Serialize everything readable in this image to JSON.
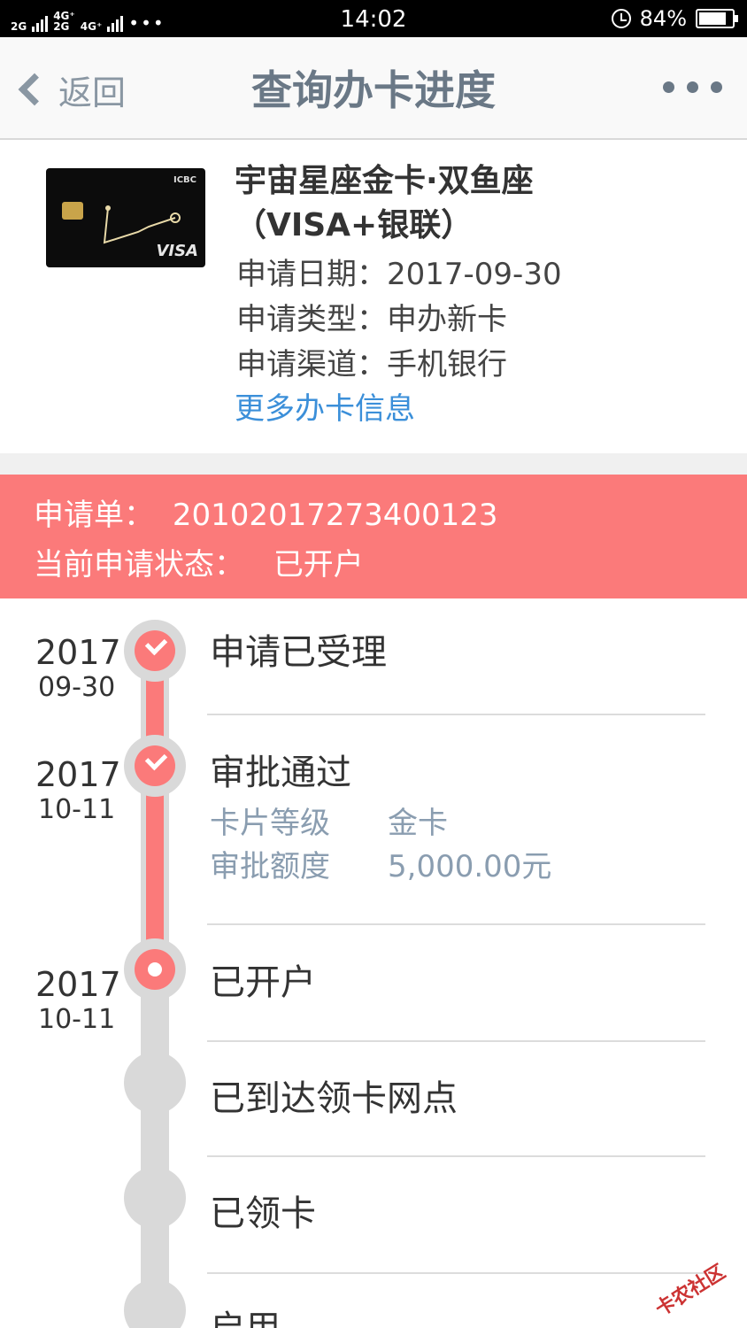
{
  "status_bar": {
    "network_1": "2G",
    "network_2a": "4G⁺",
    "network_2b": "4G⁺",
    "network_2c": "2G",
    "more": "•••",
    "time": "14:02",
    "battery": "84%",
    "battery_level": 0.84
  },
  "nav": {
    "back_label": "返回",
    "title": "查询办卡进度"
  },
  "card": {
    "name": "宇宙星座金卡·双鱼座（VISA+银联）",
    "bank_mark": "ICBC",
    "network_mark": "VISA",
    "apply_date": "申请日期：2017-09-30",
    "apply_type": "申请类型：申办新卡",
    "apply_channel": "申请渠道：手机银行",
    "more_link": "更多办卡信息"
  },
  "banner": {
    "order_label": "申请单：",
    "order_number": "20102017273400123",
    "status_label": "当前申请状态：",
    "status_value": "已开户"
  },
  "timeline": {
    "steps": [
      {
        "year": "2017",
        "date": "09-30",
        "title": "申请已受理"
      },
      {
        "year": "2017",
        "date": "10-11",
        "title": "审批通过",
        "details": [
          {
            "label": "卡片等级",
            "value": "金卡"
          },
          {
            "label": "审批额度",
            "value": "5,000.00元"
          }
        ]
      },
      {
        "year": "2017",
        "date": "10-11",
        "title": "已开户"
      },
      {
        "title": "已到达领卡网点"
      },
      {
        "title": "已领卡"
      },
      {
        "title": "启用"
      }
    ]
  },
  "watermark": "卡农社区",
  "colors": {
    "accent": "#fb7a7a",
    "link": "#3b8fd9",
    "track": "#d9d9d9",
    "nav_text": "#6a7886"
  }
}
